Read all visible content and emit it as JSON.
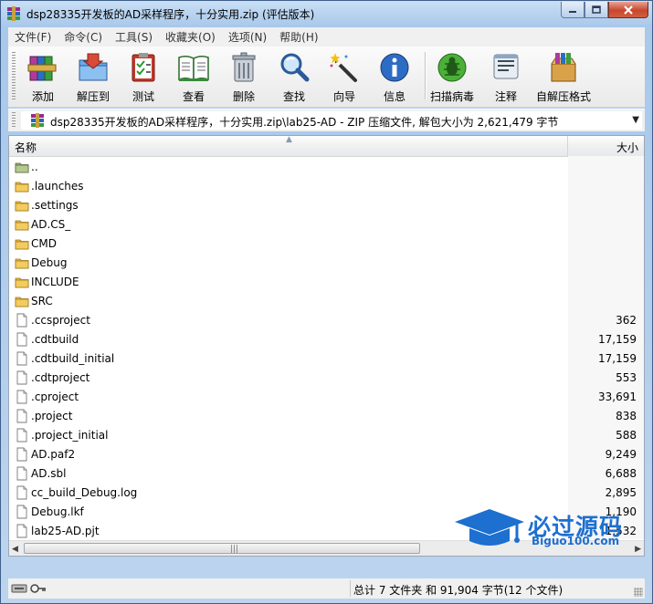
{
  "window": {
    "title": "dsp28335开发板的AD采样程序，十分实用.zip (评估版本)"
  },
  "menu": [
    "文件(F)",
    "命令(C)",
    "工具(S)",
    "收藏夹(O)",
    "选项(N)",
    "帮助(H)"
  ],
  "toolbar": [
    {
      "label": "添加",
      "icon": "add-books-icon"
    },
    {
      "label": "解压到",
      "icon": "extract-folder-icon"
    },
    {
      "label": "测试",
      "icon": "test-clipboard-icon"
    },
    {
      "label": "查看",
      "icon": "view-book-icon"
    },
    {
      "label": "删除",
      "icon": "trash-can-icon"
    },
    {
      "label": "查找",
      "icon": "magnifier-icon"
    },
    {
      "label": "向导",
      "icon": "wizard-wand-icon"
    },
    {
      "label": "信息",
      "icon": "info-icon"
    },
    {
      "label": "扫描病毒",
      "icon": "virus-scan-icon"
    },
    {
      "label": "注释",
      "icon": "comment-icon"
    },
    {
      "label": "自解压格式",
      "icon": "sfx-box-icon"
    }
  ],
  "address": {
    "path": "dsp28335开发板的AD采样程序，十分实用.zip\\lab25-AD - ZIP 压缩文件, 解包大小为 2,621,479 字节"
  },
  "list": {
    "col_name": "名称",
    "col_size": "大小",
    "rows": [
      {
        "name": "..",
        "size": "",
        "type": "parent"
      },
      {
        "name": ".launches",
        "size": "",
        "type": "folder"
      },
      {
        "name": ".settings",
        "size": "",
        "type": "folder"
      },
      {
        "name": "AD.CS_",
        "size": "",
        "type": "folder"
      },
      {
        "name": "CMD",
        "size": "",
        "type": "folder"
      },
      {
        "name": "Debug",
        "size": "",
        "type": "folder"
      },
      {
        "name": "INCLUDE",
        "size": "",
        "type": "folder"
      },
      {
        "name": "SRC",
        "size": "",
        "type": "folder"
      },
      {
        "name": ".ccsproject",
        "size": "362",
        "type": "file"
      },
      {
        "name": ".cdtbuild",
        "size": "17,159",
        "type": "file"
      },
      {
        "name": ".cdtbuild_initial",
        "size": "17,159",
        "type": "file"
      },
      {
        "name": ".cdtproject",
        "size": "553",
        "type": "file"
      },
      {
        "name": ".cproject",
        "size": "33,691",
        "type": "file"
      },
      {
        "name": ".project",
        "size": "838",
        "type": "file"
      },
      {
        "name": ".project_initial",
        "size": "588",
        "type": "file"
      },
      {
        "name": "AD.paf2",
        "size": "9,249",
        "type": "file"
      },
      {
        "name": "AD.sbl",
        "size": "6,688",
        "type": "file"
      },
      {
        "name": "cc_build_Debug.log",
        "size": "2,895",
        "type": "file"
      },
      {
        "name": "Debug.lkf",
        "size": "1,190",
        "type": "file"
      },
      {
        "name": "lab25-AD.pjt",
        "size": "1,532",
        "type": "file"
      }
    ]
  },
  "watermark": {
    "main": "必过源码",
    "sub": "Biguo100.com"
  },
  "status": {
    "text": "总计 7 文件夹 和 91,904 字节(12 个文件)"
  }
}
